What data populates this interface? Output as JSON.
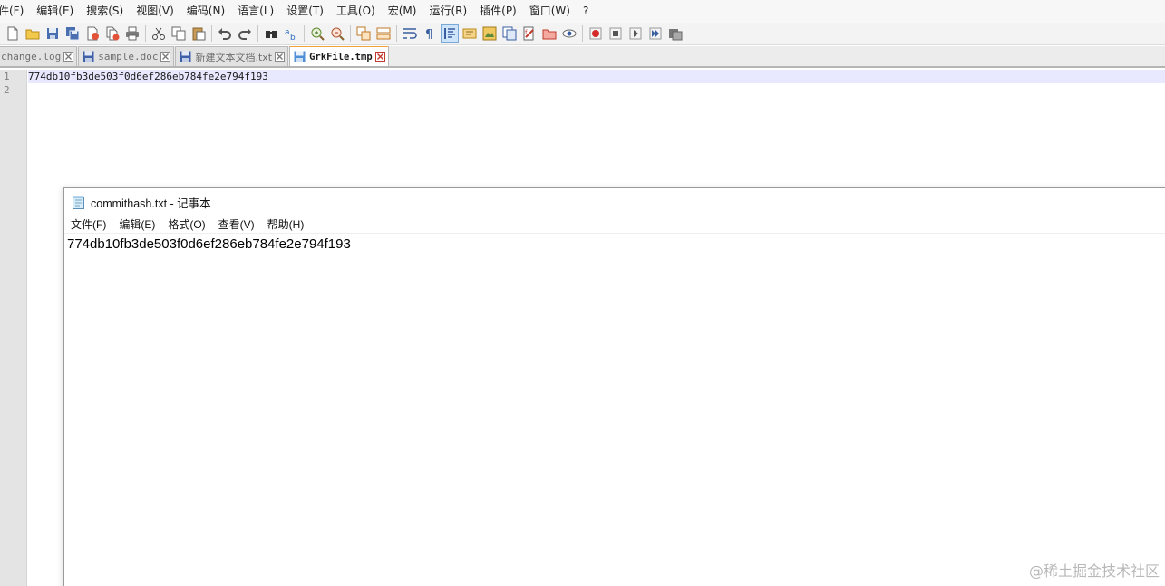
{
  "npp": {
    "menu": [
      "件(F)",
      "编辑(E)",
      "搜索(S)",
      "视图(V)",
      "编码(N)",
      "语言(L)",
      "设置(T)",
      "工具(O)",
      "宏(M)",
      "运行(R)",
      "插件(P)",
      "窗口(W)",
      "?"
    ],
    "toolbar_icons": [
      "new-file-icon",
      "open-file-icon",
      "save-icon",
      "save-all-icon",
      "close-icon",
      "close-all-icon",
      "print-icon",
      "cut-icon",
      "copy-icon",
      "paste-icon",
      "undo-icon",
      "redo-icon",
      "find-icon",
      "replace-icon",
      "zoom-in-icon",
      "zoom-out-icon",
      "sync-vertical-icon",
      "sync-horizontal-icon",
      "word-wrap-icon",
      "show-all-chars-icon",
      "indent-guide-icon",
      "user-language-icon",
      "document-map-icon",
      "function-list-icon",
      "folder-workspace-icon",
      "monitoring-icon",
      "record-macro-icon",
      "stop-record-icon",
      "play-macro-icon",
      "run-macro-multiple-icon",
      "save-macro-icon"
    ],
    "tabs": [
      {
        "label": "change.log",
        "active": false,
        "modified": false
      },
      {
        "label": "sample.doc",
        "active": false,
        "modified": false
      },
      {
        "label": "新建文本文档.txt",
        "active": false,
        "modified": false
      },
      {
        "label": "GrkFile.tmp",
        "active": true,
        "modified": false
      }
    ],
    "line_numbers": [
      "1",
      "2"
    ],
    "lines": [
      "774db10fb3de503f0d6ef286eb784fe2e794f193",
      ""
    ]
  },
  "notepad": {
    "title": "commithash.txt - 记事本",
    "menu": [
      "文件(F)",
      "编辑(E)",
      "格式(O)",
      "查看(V)",
      "帮助(H)"
    ],
    "content": "774db10fb3de503f0d6ef286eb784fe2e794f193"
  },
  "watermark": "@稀土掘金技术社区"
}
